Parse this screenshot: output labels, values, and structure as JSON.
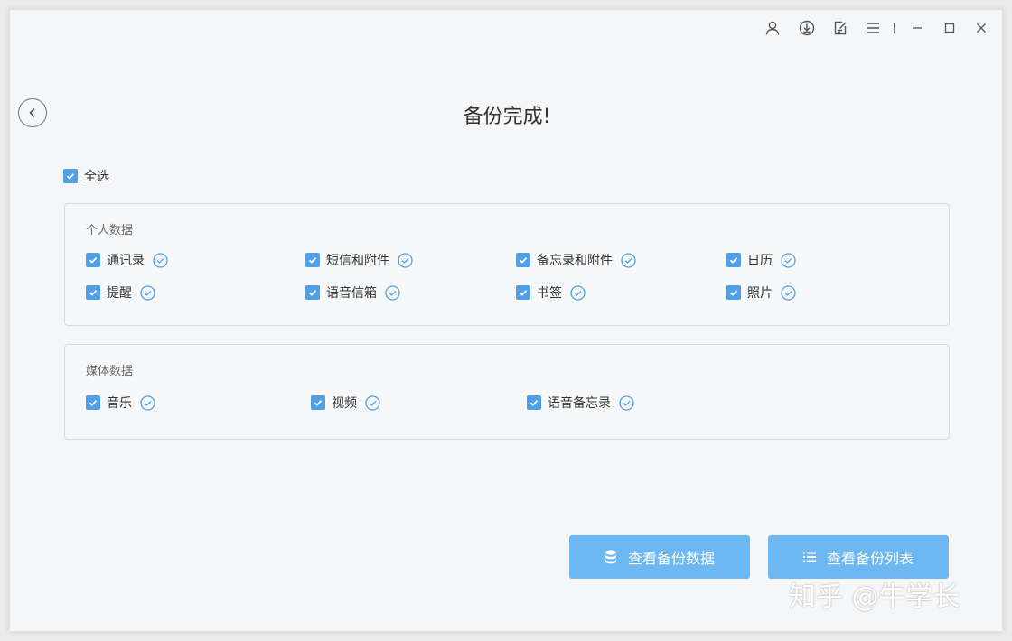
{
  "page_title": "备份完成!",
  "select_all": {
    "label": "全选",
    "checked": true
  },
  "groups": {
    "personal": {
      "title": "个人数据",
      "items": [
        {
          "label": "通讯录",
          "checked": true,
          "status": "done"
        },
        {
          "label": "短信和附件",
          "checked": true,
          "status": "done"
        },
        {
          "label": "备忘录和附件",
          "checked": true,
          "status": "done"
        },
        {
          "label": "日历",
          "checked": true,
          "status": "done"
        },
        {
          "label": "提醒",
          "checked": true,
          "status": "done"
        },
        {
          "label": "语音信箱",
          "checked": true,
          "status": "done"
        },
        {
          "label": "书签",
          "checked": true,
          "status": "done"
        },
        {
          "label": "照片",
          "checked": true,
          "status": "done"
        }
      ]
    },
    "media": {
      "title": "媒体数据",
      "items": [
        {
          "label": "音乐",
          "checked": true,
          "status": "done"
        },
        {
          "label": "视频",
          "checked": true,
          "status": "done"
        },
        {
          "label": "语音备忘录",
          "checked": true,
          "status": "done"
        }
      ]
    }
  },
  "buttons": {
    "view_data": "查看备份数据",
    "view_list": "查看备份列表"
  },
  "titlebar_icons": [
    "user-icon",
    "download-icon",
    "feedback-icon",
    "menu-icon",
    "minimize-icon",
    "maximize-icon",
    "close-icon"
  ],
  "watermark": "知乎 @牛学长",
  "colors": {
    "accent": "#4fa0e6",
    "button": "#6db8f2",
    "background": "#f5f6f8"
  }
}
